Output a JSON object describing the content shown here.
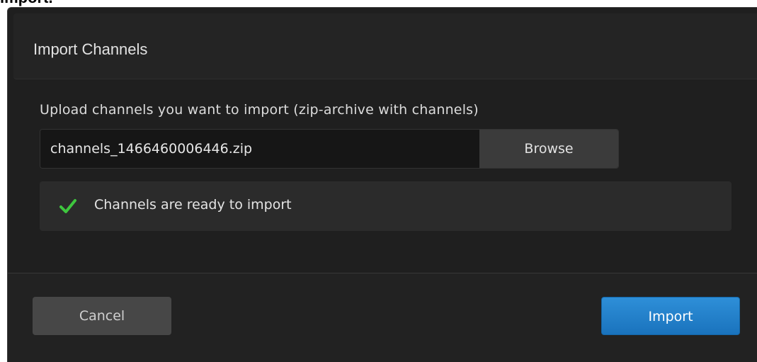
{
  "page": {
    "top_cropped_text": "import."
  },
  "dialog": {
    "title": "Import Channels",
    "upload_label": "Upload channels you want to import (zip-archive with channels)",
    "file_input": {
      "value": "channels_1466460006446.zip",
      "browse_label": "Browse"
    },
    "status": {
      "icon": "check-icon",
      "text": "Channels are ready to import",
      "color": "#3ec63e"
    },
    "footer": {
      "cancel_label": "Cancel",
      "import_label": "Import",
      "import_color": "#1f7fc9"
    }
  }
}
